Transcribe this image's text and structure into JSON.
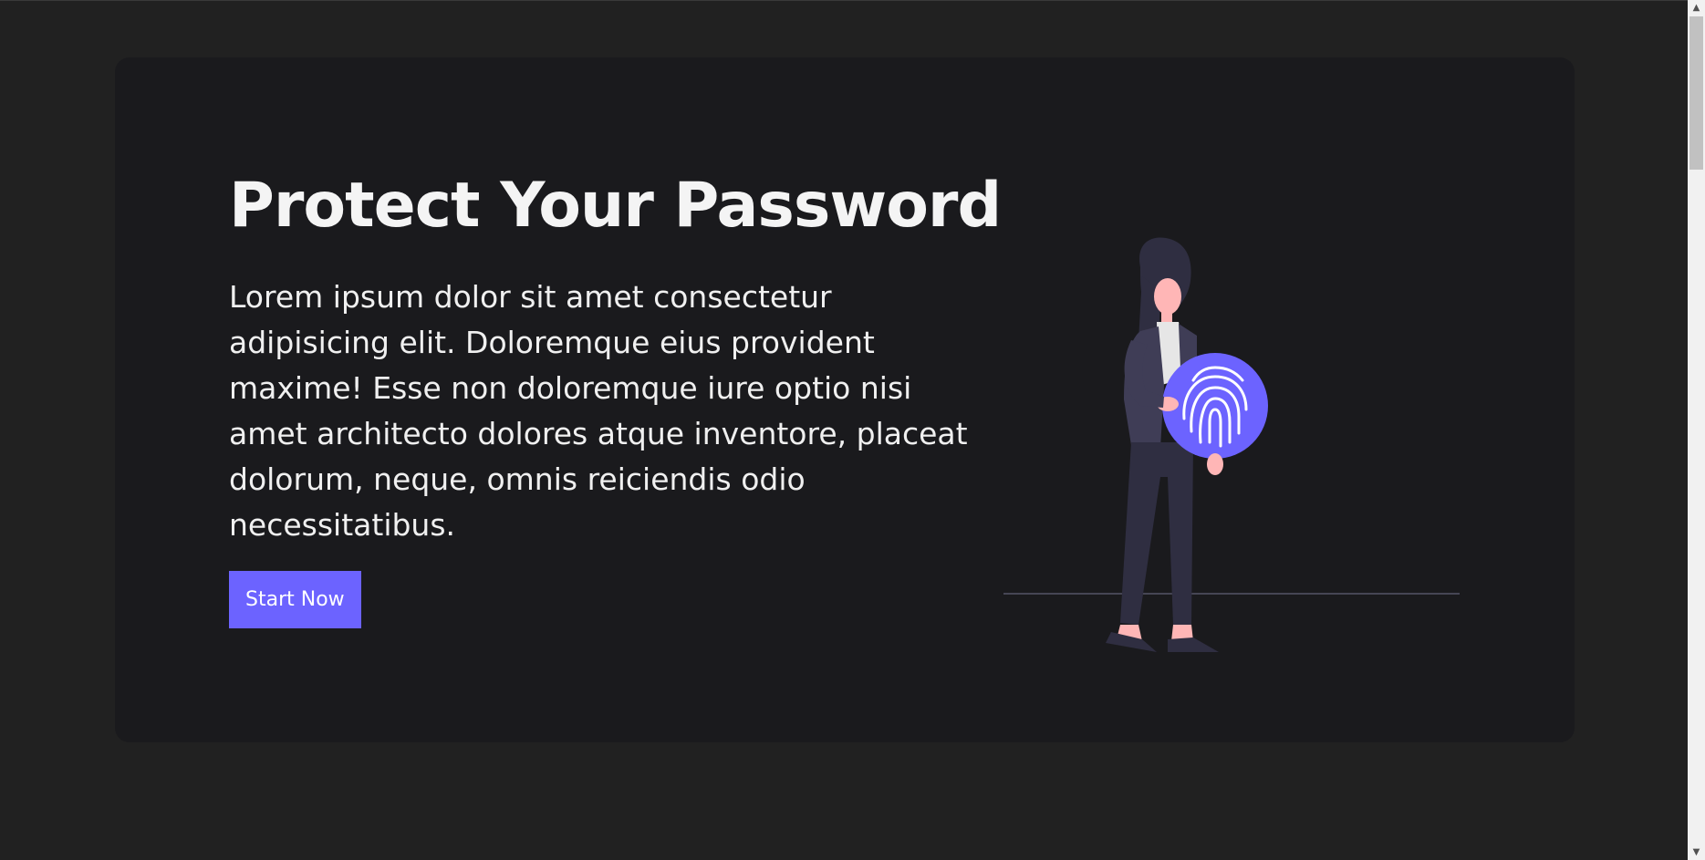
{
  "hero": {
    "title": "Protect Your Password",
    "description": "Lorem ipsum dolor sit amet consectetur adipisicing elit. Doloremque eius provident maxime! Esse non doloremque iure optio nisi amet architecto dolores atque inventore, placeat dolorum, neque, omnis reiciendis odio necessitatibus.",
    "cta_label": "Start Now"
  },
  "illustration": {
    "icon": "fingerprint-icon",
    "accent_color": "#6c63ff"
  },
  "colors": {
    "page_background": "#212121",
    "card_background": "#1a1a1d",
    "accent": "#6c63ff",
    "text": "#f4f4f4"
  },
  "scrollbar": {
    "up_glyph": "▲",
    "down_glyph": "▼"
  }
}
